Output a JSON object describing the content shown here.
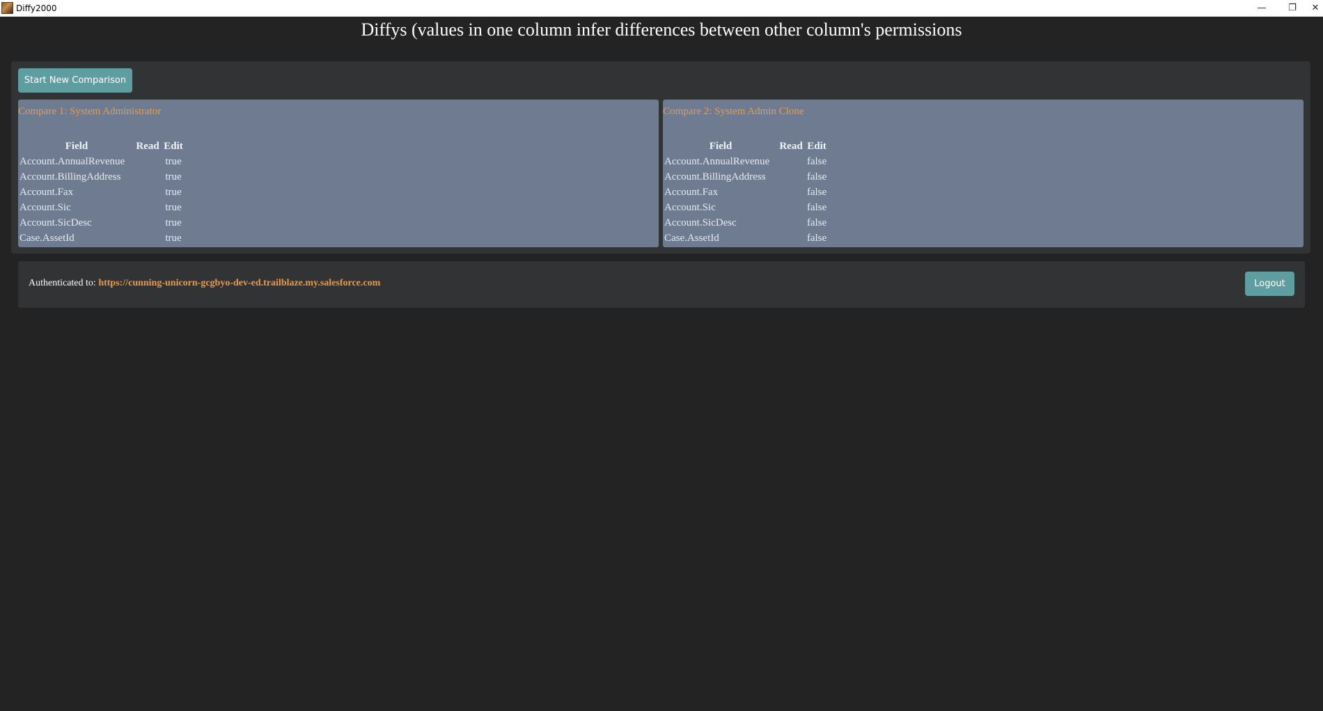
{
  "window": {
    "title": "Diffy2000",
    "controls": {
      "minimize": "—",
      "restore": "❐",
      "close": "✕"
    }
  },
  "heading": "Diffys (values in one column infer differences between other column's permissions",
  "toolbar": {
    "start_label": "Start New Comparison"
  },
  "compare1": {
    "title": "Compare 1: System Administrator",
    "headers": {
      "field": "Field",
      "read": "Read",
      "edit": "Edit"
    },
    "rows": [
      {
        "field": "Account.AnnualRevenue",
        "read": "",
        "edit": "true"
      },
      {
        "field": "Account.BillingAddress",
        "read": "",
        "edit": "true"
      },
      {
        "field": "Account.Fax",
        "read": "",
        "edit": "true"
      },
      {
        "field": "Account.Sic",
        "read": "",
        "edit": "true"
      },
      {
        "field": "Account.SicDesc",
        "read": "",
        "edit": "true"
      },
      {
        "field": "Case.AssetId",
        "read": "",
        "edit": "true"
      }
    ]
  },
  "compare2": {
    "title": "Compare 2: System Admin Clone",
    "headers": {
      "field": "Field",
      "read": "Read",
      "edit": "Edit"
    },
    "rows": [
      {
        "field": "Account.AnnualRevenue",
        "read": "",
        "edit": "false"
      },
      {
        "field": "Account.BillingAddress",
        "read": "",
        "edit": "false"
      },
      {
        "field": "Account.Fax",
        "read": "",
        "edit": "false"
      },
      {
        "field": "Account.Sic",
        "read": "",
        "edit": "false"
      },
      {
        "field": "Account.SicDesc",
        "read": "",
        "edit": "false"
      },
      {
        "field": "Case.AssetId",
        "read": "",
        "edit": "false"
      }
    ]
  },
  "auth": {
    "label": "Authenticated to: ",
    "url": "https://cunning-unicorn-gcgbyo-dev-ed.trailblaze.my.salesforce.com",
    "logout_label": "Logout"
  },
  "colors": {
    "background": "#232323",
    "panel": "#323335",
    "compare_panel": "#6e7b91",
    "button": "#5f9ea0",
    "accent_orange": "#e99a4b"
  },
  "icons": {
    "app": "app-icon"
  }
}
